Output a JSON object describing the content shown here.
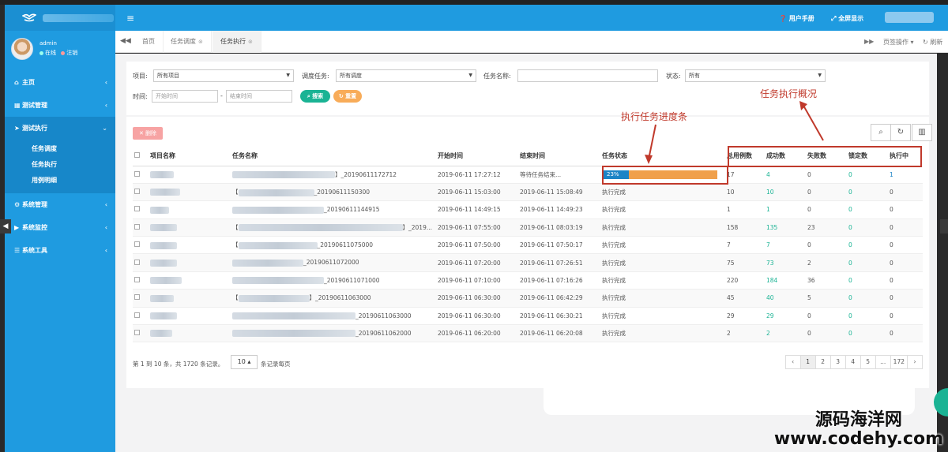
{
  "app": {
    "user_name": "admin",
    "status_online": "在线",
    "status_logout": "注销"
  },
  "topbar": {
    "manual": "用户手册",
    "fullscreen": "全屏显示"
  },
  "sidebar": {
    "items": [
      {
        "label": "主页"
      },
      {
        "label": "测试管理"
      },
      {
        "label": "测试执行"
      },
      {
        "label": "系统管理"
      },
      {
        "label": "系统监控"
      },
      {
        "label": "系统工具"
      }
    ],
    "submenu": [
      "任务调度",
      "任务执行",
      "用例明细"
    ]
  },
  "tabs": {
    "home": "首页",
    "t1": "任务调度",
    "t2": "任务执行",
    "page_ops": "页签操作",
    "refresh": "刷新"
  },
  "filters": {
    "project_label": "项目:",
    "project_value": "所有项目",
    "schedule_label": "调度任务:",
    "schedule_value": "所有调度",
    "taskname_label": "任务名称:",
    "status_label": "状态:",
    "status_value": "所有",
    "time_label": "时间:",
    "start_placeholder": "开始时间",
    "end_placeholder": "结束时间",
    "search": "搜索",
    "reset": "重置"
  },
  "table": {
    "delete": "删除",
    "headers": {
      "project": "项目名称",
      "task": "任务名称",
      "start": "开始时间",
      "end": "结束时间",
      "status": "任务状态",
      "total": "总用例数",
      "success": "成功数",
      "fail": "失败数",
      "locked": "锁定数",
      "running": "执行中"
    },
    "rows": [
      {
        "task_suffix": "】_20190611172712",
        "start": "2019-06-11 17:27:12",
        "end": "等待任务结束...",
        "status": "",
        "progress": 0.23,
        "progress_label": "23%",
        "total": "17",
        "success": "4",
        "fail": "0",
        "locked": "0",
        "running": "1"
      },
      {
        "task_suffix": "_20190611150300",
        "start": "2019-06-11 15:03:00",
        "end": "2019-06-11 15:08:49",
        "status": "执行完成",
        "total": "10",
        "success": "10",
        "fail": "0",
        "locked": "0",
        "running": "0"
      },
      {
        "task_suffix": "_20190611144915",
        "start": "2019-06-11 14:49:15",
        "end": "2019-06-11 14:49:23",
        "status": "执行完成",
        "total": "1",
        "success": "1",
        "fail": "0",
        "locked": "0",
        "running": "0"
      },
      {
        "task_suffix": "】_2019...",
        "start": "2019-06-11 07:55:00",
        "end": "2019-06-11 08:03:19",
        "status": "执行完成",
        "total": "158",
        "success": "135",
        "fail": "23",
        "locked": "0",
        "running": "0"
      },
      {
        "task_suffix": "_20190611075000",
        "start": "2019-06-11 07:50:00",
        "end": "2019-06-11 07:50:17",
        "status": "执行完成",
        "total": "7",
        "success": "7",
        "fail": "0",
        "locked": "0",
        "running": "0"
      },
      {
        "task_suffix": "_20190611072000",
        "start": "2019-06-11 07:20:00",
        "end": "2019-06-11 07:26:51",
        "status": "执行完成",
        "total": "75",
        "success": "73",
        "fail": "2",
        "locked": "0",
        "running": "0"
      },
      {
        "task_suffix": "_20190611071000",
        "start": "2019-06-11 07:10:00",
        "end": "2019-06-11 07:16:26",
        "status": "执行完成",
        "total": "220",
        "success": "184",
        "fail": "36",
        "locked": "0",
        "running": "0"
      },
      {
        "task_suffix": "】_20190611063000",
        "start": "2019-06-11 06:30:00",
        "end": "2019-06-11 06:42:29",
        "status": "执行完成",
        "total": "45",
        "success": "40",
        "fail": "5",
        "locked": "0",
        "running": "0"
      },
      {
        "task_suffix": "_20190611063000",
        "start": "2019-06-11 06:30:00",
        "end": "2019-06-11 06:30:21",
        "status": "执行完成",
        "total": "29",
        "success": "29",
        "fail": "0",
        "locked": "0",
        "running": "0"
      },
      {
        "task_suffix": "_20190611062000",
        "start": "2019-06-11 06:20:00",
        "end": "2019-06-11 06:20:08",
        "status": "执行完成",
        "total": "2",
        "success": "2",
        "fail": "0",
        "locked": "0",
        "running": "0"
      }
    ],
    "footer_info": "第 1 到 10 条，共 1720 条记录。",
    "page_size": "10",
    "page_size_label": "条记录每页",
    "pages": [
      "‹",
      "1",
      "2",
      "3",
      "4",
      "5",
      "...",
      "172",
      "›"
    ]
  },
  "annotations": {
    "progress": "执行任务进度条",
    "overview": "任务执行概况"
  },
  "watermark": {
    "line1": "源码海洋网",
    "line2": "www.codehy.com"
  },
  "colors": {
    "primary": "#1f9be0",
    "success": "#1ab394",
    "warning": "#f8ac59",
    "danger": "#ed5565",
    "annotation": "#c0392b"
  }
}
